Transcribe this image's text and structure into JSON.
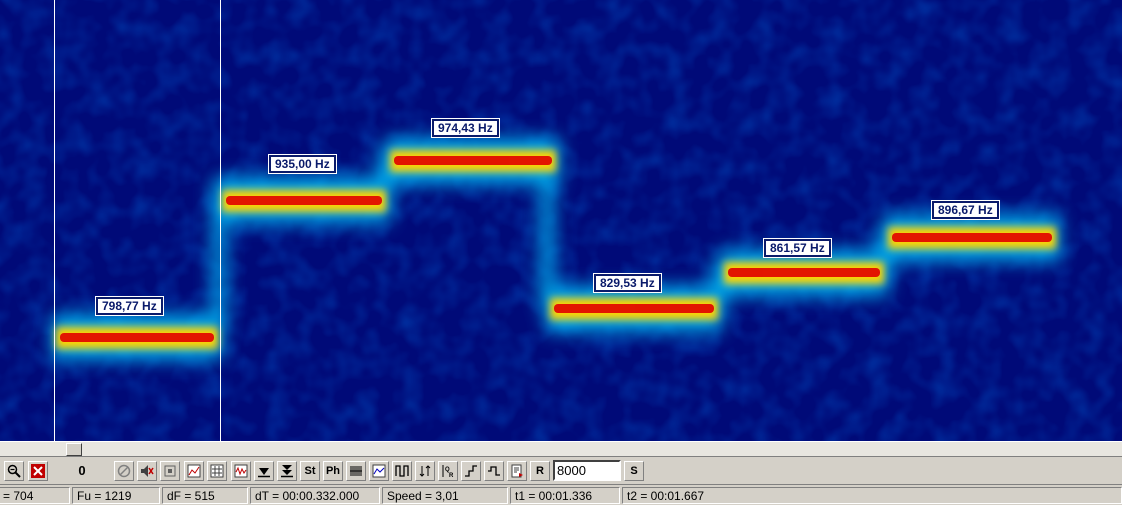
{
  "spectrogram": {
    "labels": [
      "798,77 Hz",
      "935,00 Hz",
      "974,43 Hz",
      "829,53 Hz",
      "861,57 Hz",
      "896,67 Hz"
    ]
  },
  "toolbar": {
    "counter": "0",
    "st_label": "St",
    "ph_label": "Ph",
    "r_label": "R",
    "rate_value": "8000",
    "s_label": "S"
  },
  "status": {
    "f": "= 704",
    "fu": "Fu = 1219",
    "df": "dF = 515",
    "dt": "dT = 00:00.332.000",
    "speed": "Speed = 3,01",
    "t1": "t1 = 00:01.336",
    "t2": "t2 = 00:01.667"
  },
  "colors": {
    "background": "#000a78",
    "hot": "#e00000",
    "warm": "#ffd000",
    "cool": "#00e0ff"
  }
}
